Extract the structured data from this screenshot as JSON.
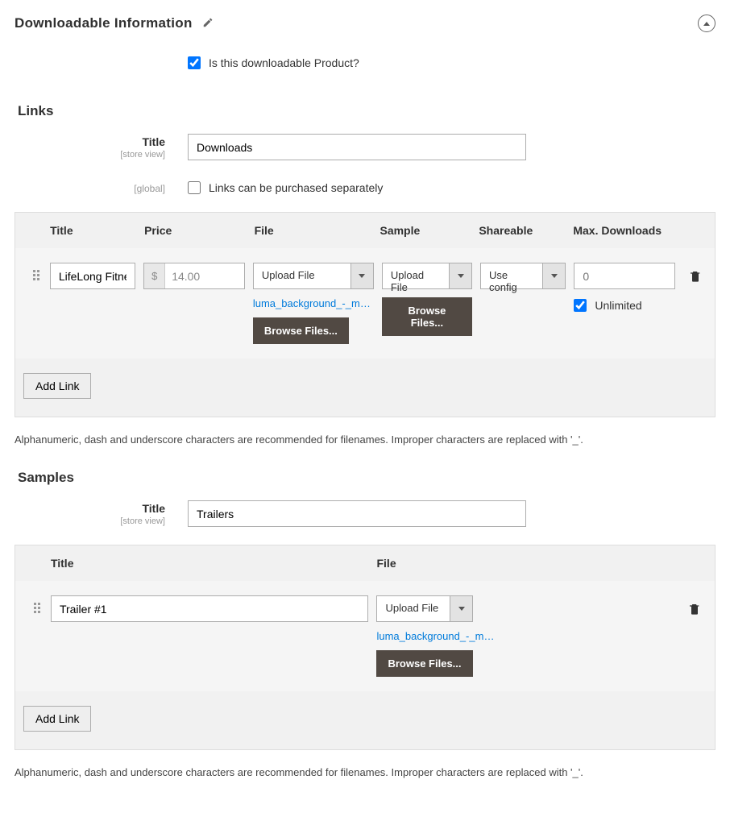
{
  "header": {
    "title": "Downloadable Information"
  },
  "is_downloadable": {
    "label": "Is this downloadable Product?",
    "checked": true
  },
  "links": {
    "heading": "Links",
    "title_label": "Title",
    "title_scope": "[store view]",
    "title_value": "Downloads",
    "separately_label": "Links can be purchased separately",
    "separately_scope": "[global]",
    "separately_checked": false,
    "columns": {
      "title": "Title",
      "price": "Price",
      "file": "File",
      "sample": "Sample",
      "shareable": "Shareable",
      "max": "Max. Downloads"
    },
    "row": {
      "title": "LifeLong Fitness IV",
      "price": "14.00",
      "file_mode": "Upload File",
      "file_name": "luma_background_-_mo...",
      "browse": "Browse Files...",
      "sample_mode": "Upload File",
      "shareable": "Use config",
      "max_placeholder": "0",
      "unlimited_label": "Unlimited",
      "unlimited_checked": true
    },
    "add_link": "Add Link"
  },
  "note": "Alphanumeric, dash and underscore characters are recommended for filenames. Improper characters are replaced with '_'.",
  "samples": {
    "heading": "Samples",
    "title_label": "Title",
    "title_scope": "[store view]",
    "title_value": "Trailers",
    "columns": {
      "title": "Title",
      "file": "File"
    },
    "row": {
      "title": "Trailer #1",
      "file_mode": "Upload File",
      "file_name": "luma_background_-_mo...",
      "browse": "Browse Files..."
    },
    "add_link": "Add Link"
  }
}
